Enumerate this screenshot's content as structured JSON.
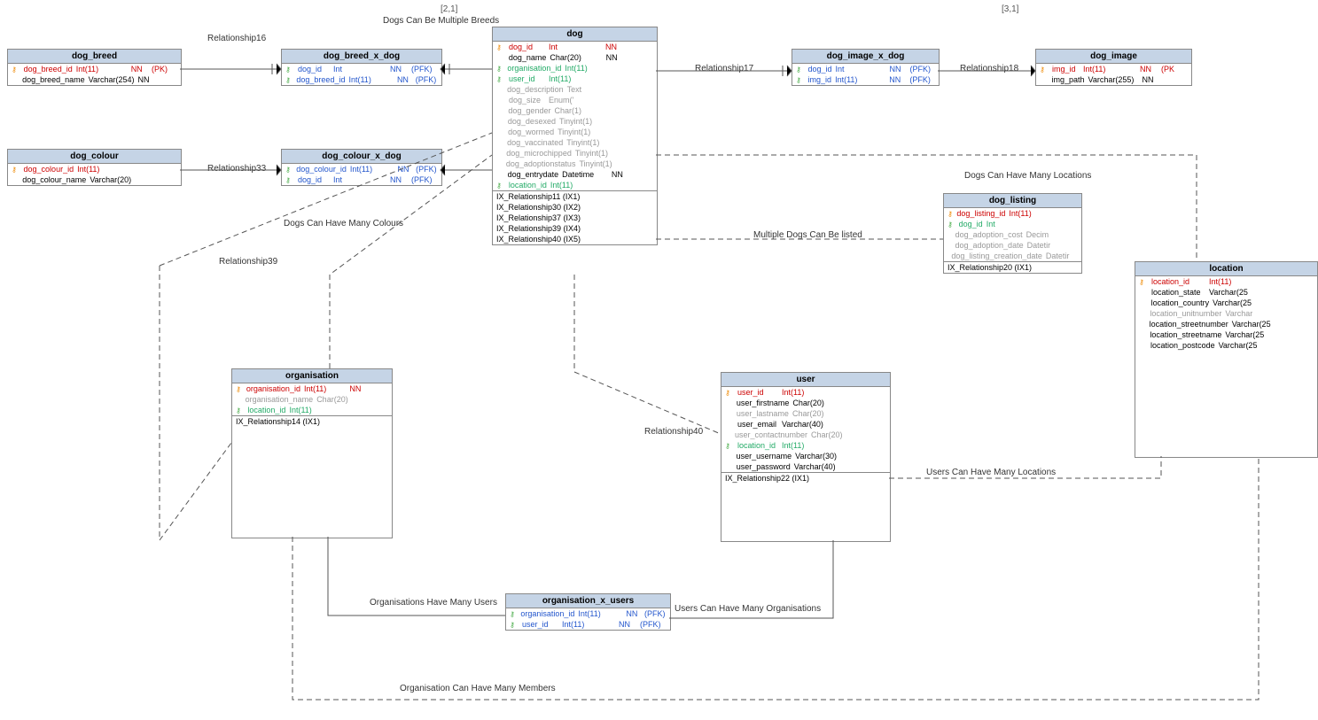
{
  "brackets": {
    "b1": "[2,1]",
    "b2": "[3,1]"
  },
  "labels": {
    "rel16": "Relationship16",
    "multBreeds": "Dogs Can Be Multiple Breeds",
    "rel17": "Relationship17",
    "rel18": "Relationship18",
    "rel33": "Relationship33",
    "manyColours": "Dogs Can Have Many Colours",
    "rel39": "Relationship39",
    "multDogsListed": "Multiple Dogs Can Be listed",
    "manyLocations": "Dogs Can Have Many Locations",
    "rel40": "Relationship40",
    "usersManyLoc": "Users Can Have Many Locations",
    "orgManyUsers": "Organisations Have Many Users",
    "usersManyOrg": "Users Can Have Many Organisations",
    "orgManyMembers": "Organisation Can Have Many Members"
  },
  "entities": {
    "dog_breed": {
      "title": "dog_breed",
      "rows": [
        {
          "icon": "pk",
          "name": "dog_breed_id",
          "type": "Int(11)",
          "nn": "NN",
          "pk": "(PK)",
          "cls": "pk"
        },
        {
          "icon": "",
          "name": "dog_breed_name",
          "type": "Varchar(254)",
          "nn": "NN",
          "pk": ""
        }
      ]
    },
    "dog_breed_x_dog": {
      "title": "dog_breed_x_dog",
      "rows": [
        {
          "icon": "fk",
          "name": "dog_id",
          "type": "Int",
          "nn": "NN",
          "pk": "(PFK)",
          "cls": "bluekey"
        },
        {
          "icon": "fk",
          "name": "dog_breed_id",
          "type": "Int(11)",
          "nn": "NN",
          "pk": "(PFK)",
          "cls": "bluekey"
        }
      ]
    },
    "dog_colour": {
      "title": "dog_colour",
      "rows": [
        {
          "icon": "pk",
          "name": "dog_colour_id",
          "type": "Int(11)",
          "nn": "",
          "pk": "",
          "cls": "pk"
        },
        {
          "icon": "",
          "name": "dog_colour_name",
          "type": "Varchar(20)",
          "nn": "",
          "pk": ""
        }
      ]
    },
    "dog_colour_x_dog": {
      "title": "dog_colour_x_dog",
      "rows": [
        {
          "icon": "fk",
          "name": "dog_colour_id",
          "type": "Int(11)",
          "nn": "NN",
          "pk": "(PFK)",
          "cls": "bluekey"
        },
        {
          "icon": "fk",
          "name": "dog_id",
          "type": "Int",
          "nn": "NN",
          "pk": "(PFK)",
          "cls": "bluekey"
        }
      ]
    },
    "dog": {
      "title": "dog",
      "rows": [
        {
          "icon": "pk",
          "name": "dog_id",
          "type": "Int",
          "nn": "NN",
          "pk": "",
          "cls": "pk"
        },
        {
          "icon": "",
          "name": "dog_name",
          "type": "Char(20)",
          "nn": "NN",
          "pk": ""
        },
        {
          "icon": "fk",
          "name": "organisation_id",
          "type": "Int(11)",
          "nn": "",
          "pk": "",
          "cls": "fk"
        },
        {
          "icon": "fk",
          "name": "user_id",
          "type": "Int(11)",
          "nn": "",
          "pk": "",
          "cls": "fk"
        },
        {
          "icon": "",
          "name": "dog_description",
          "type": "Text",
          "nn": "",
          "pk": "",
          "cls": "grey"
        },
        {
          "icon": "",
          "name": "dog_size",
          "type": "Enum('",
          "nn": "",
          "pk": "",
          "cls": "grey"
        },
        {
          "icon": "",
          "name": "dog_gender",
          "type": "Char(1)",
          "nn": "",
          "pk": "",
          "cls": "grey"
        },
        {
          "icon": "",
          "name": "dog_desexed",
          "type": "Tinyint(1)",
          "nn": "",
          "pk": "",
          "cls": "grey"
        },
        {
          "icon": "",
          "name": "dog_wormed",
          "type": "Tinyint(1)",
          "nn": "",
          "pk": "",
          "cls": "grey"
        },
        {
          "icon": "",
          "name": "dog_vaccinated",
          "type": "Tinyint(1)",
          "nn": "",
          "pk": "",
          "cls": "grey"
        },
        {
          "icon": "",
          "name": "dog_microchipped",
          "type": "Tinyint(1)",
          "nn": "",
          "pk": "",
          "cls": "grey"
        },
        {
          "icon": "",
          "name": "dog_adoptionstatus",
          "type": "Tinyint(1)",
          "nn": "",
          "pk": "",
          "cls": "grey"
        },
        {
          "icon": "",
          "name": "dog_entrydate",
          "type": "Datetime",
          "nn": "NN",
          "pk": ""
        },
        {
          "icon": "fk",
          "name": "location_id",
          "type": "Int(11)",
          "nn": "",
          "pk": "",
          "cls": "fk"
        }
      ],
      "indexes": [
        "IX_Relationship11 (IX1)",
        "IX_Relationship30 (IX2)",
        "IX_Relationship37 (IX3)",
        "IX_Relationship39 (IX4)",
        "IX_Relationship40 (IX5)"
      ]
    },
    "dog_image_x_dog": {
      "title": "dog_image_x_dog",
      "rows": [
        {
          "icon": "fk",
          "name": "dog_id",
          "type": "Int",
          "nn": "NN",
          "pk": "(PFK)",
          "cls": "bluekey"
        },
        {
          "icon": "fk",
          "name": "img_id",
          "type": "Int(11)",
          "nn": "NN",
          "pk": "(PFK)",
          "cls": "bluekey"
        }
      ]
    },
    "dog_image": {
      "title": "dog_image",
      "rows": [
        {
          "icon": "pk",
          "name": "img_id",
          "type": "Int(11)",
          "nn": "NN",
          "pk": "(PK",
          "cls": "pk"
        },
        {
          "icon": "",
          "name": "img_path",
          "type": "Varchar(255)",
          "nn": "NN",
          "pk": ""
        }
      ]
    },
    "organisation": {
      "title": "organisation",
      "rows": [
        {
          "icon": "pk",
          "name": "organisation_id",
          "type": "Int(11)",
          "nn": "NN",
          "pk": "",
          "cls": "pk"
        },
        {
          "icon": "",
          "name": "organisation_name",
          "type": "Char(20)",
          "nn": "",
          "pk": "",
          "cls": "grey"
        },
        {
          "icon": "fk",
          "name": "location_id",
          "type": "Int(11)",
          "nn": "",
          "pk": "",
          "cls": "fk"
        }
      ],
      "indexes": [
        "IX_Relationship14 (IX1)"
      ]
    },
    "user": {
      "title": "user",
      "rows": [
        {
          "icon": "pk",
          "name": "user_id",
          "type": "Int(11)",
          "nn": "",
          "pk": "",
          "cls": "pk"
        },
        {
          "icon": "",
          "name": "user_firstname",
          "type": "Char(20)",
          "nn": "",
          "pk": ""
        },
        {
          "icon": "",
          "name": "user_lastname",
          "type": "Char(20)",
          "nn": "",
          "pk": "",
          "cls": "grey"
        },
        {
          "icon": "",
          "name": "user_email",
          "type": "Varchar(40)",
          "nn": "",
          "pk": ""
        },
        {
          "icon": "",
          "name": "user_contactnumber",
          "type": "Char(20)",
          "nn": "",
          "pk": "",
          "cls": "grey"
        },
        {
          "icon": "fk",
          "name": "location_id",
          "type": "Int(11)",
          "nn": "",
          "pk": "",
          "cls": "fk"
        },
        {
          "icon": "",
          "name": "user_username",
          "type": "Varchar(30)",
          "nn": "",
          "pk": ""
        },
        {
          "icon": "",
          "name": "user_password",
          "type": "Varchar(40)",
          "nn": "",
          "pk": ""
        }
      ],
      "indexes": [
        "IX_Relationship22 (IX1)"
      ]
    },
    "dog_listing": {
      "title": "dog_listing",
      "rows": [
        {
          "icon": "pk",
          "name": "dog_listing_id",
          "type": "Int(11)",
          "nn": "",
          "pk": "",
          "cls": "pk"
        },
        {
          "icon": "fk",
          "name": "dog_id",
          "type": "Int",
          "nn": "",
          "pk": "",
          "cls": "fk"
        },
        {
          "icon": "",
          "name": "dog_adoption_cost",
          "type": "Decim",
          "nn": "",
          "pk": "",
          "cls": "grey"
        },
        {
          "icon": "",
          "name": "dog_adoption_date",
          "type": "Datetir",
          "nn": "",
          "pk": "",
          "cls": "grey"
        },
        {
          "icon": "",
          "name": "dog_listing_creation_date",
          "type": "Datetir",
          "nn": "",
          "pk": "",
          "cls": "grey"
        }
      ],
      "indexes": [
        "IX_Relationship20 (IX1)"
      ]
    },
    "location": {
      "title": "location",
      "rows": [
        {
          "icon": "pk",
          "name": "location_id",
          "type": "Int(11)",
          "nn": "",
          "pk": "",
          "cls": "pk"
        },
        {
          "icon": "",
          "name": "location_state",
          "type": "Varchar(25",
          "nn": "",
          "pk": ""
        },
        {
          "icon": "",
          "name": "location_country",
          "type": "Varchar(25",
          "nn": "",
          "pk": ""
        },
        {
          "icon": "",
          "name": "location_unitnumber",
          "type": "Varchar",
          "nn": "",
          "pk": "",
          "cls": "grey"
        },
        {
          "icon": "",
          "name": "location_streetnumber",
          "type": "Varchar(25",
          "nn": "",
          "pk": ""
        },
        {
          "icon": "",
          "name": "location_streetname",
          "type": "Varchar(25",
          "nn": "",
          "pk": ""
        },
        {
          "icon": "",
          "name": "location_postcode",
          "type": "Varchar(25",
          "nn": "",
          "pk": ""
        }
      ]
    },
    "organisation_x_users": {
      "title": "organisation_x_users",
      "rows": [
        {
          "icon": "fk",
          "name": "organisation_id",
          "type": "Int(11)",
          "nn": "NN",
          "pk": "(PFK)",
          "cls": "bluekey"
        },
        {
          "icon": "fk",
          "name": "user_id",
          "type": "Int(11)",
          "nn": "NN",
          "pk": "(PFK)",
          "cls": "bluekey"
        }
      ]
    }
  }
}
